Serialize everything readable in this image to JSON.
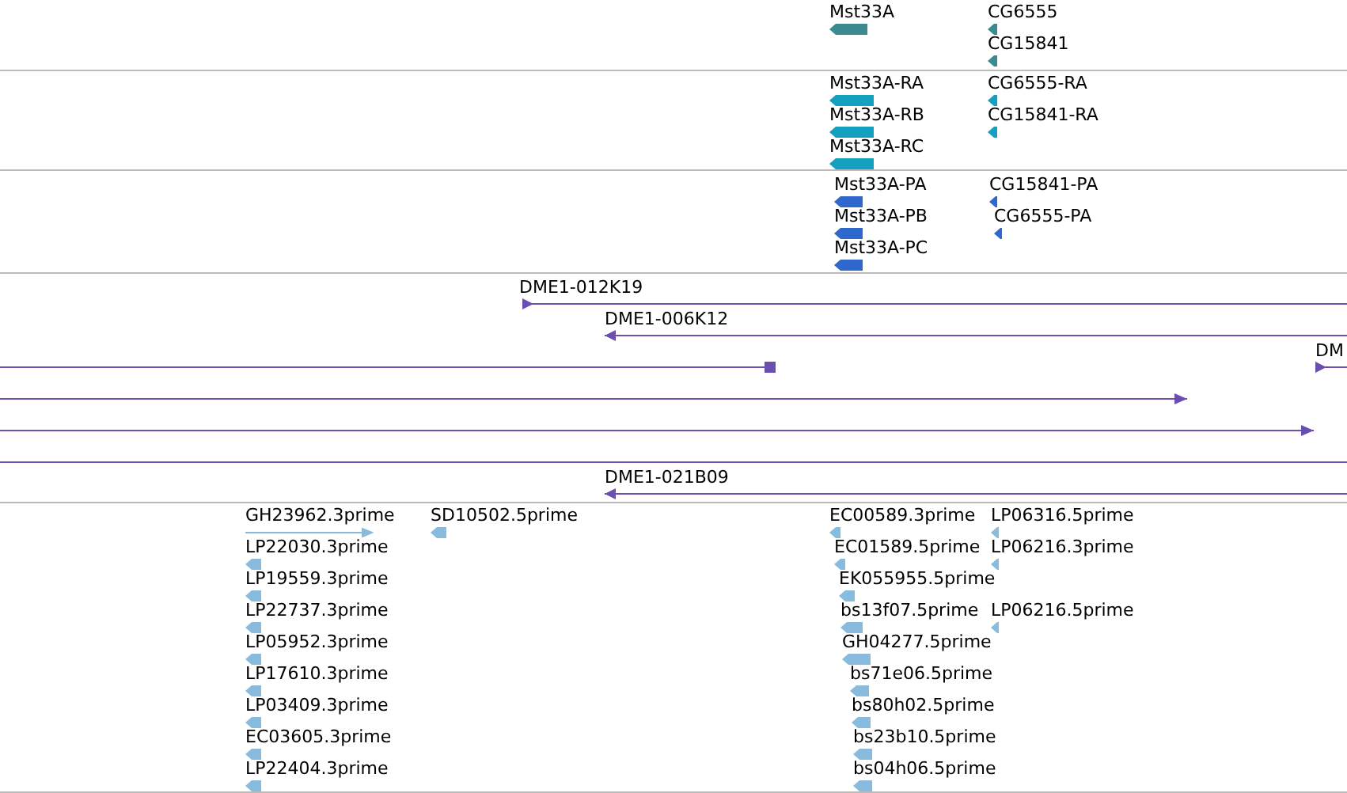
{
  "tracks": [
    {
      "kind": "gene",
      "color": "#3a8a8f",
      "features": [
        {
          "label": "Mst33A",
          "reverse": true
        },
        {
          "label": "CG6555",
          "reverse": true
        },
        {
          "label": "CG15841",
          "reverse": true
        }
      ]
    },
    {
      "kind": "gene",
      "color": "#15a0c0",
      "features": [
        {
          "label": "Mst33A-RA",
          "reverse": true
        },
        {
          "label": "Mst33A-RB",
          "reverse": true
        },
        {
          "label": "Mst33A-RC",
          "reverse": true
        },
        {
          "label": "CG6555-RA",
          "reverse": true
        },
        {
          "label": "CG15841-RA",
          "reverse": true
        }
      ]
    },
    {
      "kind": "gene",
      "color": "#2e68cc",
      "features": [
        {
          "label": "Mst33A-PA",
          "reverse": true
        },
        {
          "label": "Mst33A-PB",
          "reverse": true
        },
        {
          "label": "Mst33A-PC",
          "reverse": true
        },
        {
          "label": "CG15841-PA",
          "reverse": true
        },
        {
          "label": "CG6555-PA",
          "reverse": true
        }
      ]
    },
    {
      "kind": "clone",
      "color": "#6a4fb0",
      "features": [
        {
          "label": "DME1-012K19",
          "reverse": false
        },
        {
          "label": "DME1-006K12",
          "reverse": true
        },
        {
          "reverse": true
        },
        {
          "label": "DM",
          "reverse": false
        },
        {
          "reverse": false
        },
        {
          "reverse": false
        },
        {
          "label": "DME1-021B09",
          "reverse": true
        }
      ]
    },
    {
      "kind": "gene",
      "color": "#88bbdd",
      "features": [
        {
          "label": "GH23962.3prime",
          "reverse": false
        },
        {
          "label": "LP22030.3prime",
          "reverse": true
        },
        {
          "label": "LP19559.3prime",
          "reverse": true
        },
        {
          "label": "LP22737.3prime",
          "reverse": true
        },
        {
          "label": "LP05952.3prime",
          "reverse": true
        },
        {
          "label": "LP17610.3prime",
          "reverse": true
        },
        {
          "label": "LP03409.3prime",
          "reverse": true
        },
        {
          "label": "EC03605.3prime",
          "reverse": true
        },
        {
          "label": "LP22404.3prime",
          "reverse": true
        },
        {
          "label": "SD10502.5prime",
          "reverse": true
        },
        {
          "label": "EC00589.3prime",
          "reverse": true
        },
        {
          "label": "LP06316.5prime",
          "reverse": true
        },
        {
          "label": "EC01589.5prime",
          "reverse": true
        },
        {
          "label": "LP06216.3prime",
          "reverse": true
        },
        {
          "label": "EK055955.5prime",
          "reverse": true
        },
        {
          "label": "bs13f07.5prime",
          "reverse": true
        },
        {
          "label": "LP06216.5prime",
          "reverse": true
        },
        {
          "label": "GH04277.5prime",
          "reverse": true
        },
        {
          "label": "bs71e06.5prime",
          "reverse": true
        },
        {
          "label": "bs80h02.5prime",
          "reverse": true
        },
        {
          "label": "bs23b10.5prime",
          "reverse": true
        },
        {
          "label": "bs04h06.5prime",
          "reverse": true
        }
      ]
    }
  ]
}
